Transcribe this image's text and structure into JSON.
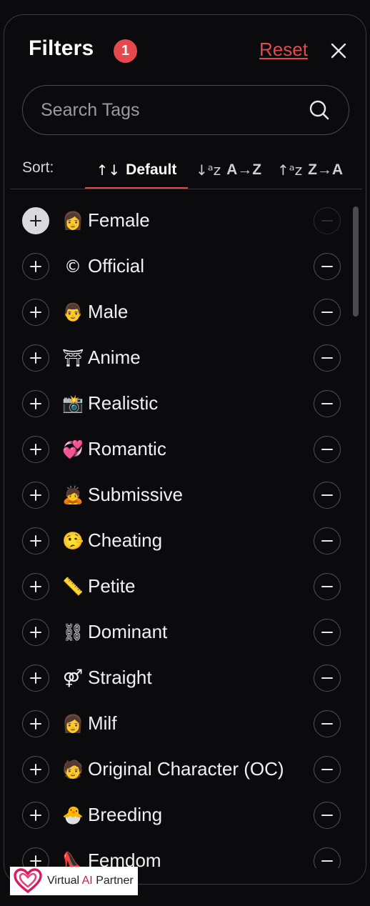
{
  "header": {
    "title": "Filters",
    "active_count": "1",
    "reset_label": "Reset",
    "close_icon": "close-icon"
  },
  "search": {
    "placeholder": "Search Tags",
    "value": "",
    "icon": "search-icon"
  },
  "sort": {
    "label": "Sort:",
    "options": [
      {
        "label": "Default",
        "icon": "↑↓",
        "active": true
      },
      {
        "label": "A→Z",
        "icon": "↓ᵃz",
        "active": false
      },
      {
        "label": "Z→A",
        "icon": "↑ᵃz",
        "active": false
      }
    ],
    "accent_color": "#e5484d"
  },
  "tags": [
    {
      "emoji": "👩",
      "label": "Female"
    },
    {
      "emoji": "©",
      "label": "Official"
    },
    {
      "emoji": "👨",
      "label": "Male"
    },
    {
      "emoji": "⛩",
      "label": "Anime"
    },
    {
      "emoji": "📸",
      "label": "Realistic"
    },
    {
      "emoji": "💞",
      "label": "Romantic"
    },
    {
      "emoji": "🙇",
      "label": "Submissive"
    },
    {
      "emoji": "🤥",
      "label": "Cheating"
    },
    {
      "emoji": "📏",
      "label": "Petite"
    },
    {
      "emoji": "⛓",
      "label": "Dominant"
    },
    {
      "emoji": "⚤",
      "label": "Straight"
    },
    {
      "emoji": "👩",
      "label": "Milf"
    },
    {
      "emoji": "🧑",
      "label": "Original Character (OC)"
    },
    {
      "emoji": "🐣",
      "label": "Breeding"
    },
    {
      "emoji": "👠",
      "label": "Femdom"
    }
  ],
  "watermark": {
    "text_prefix": "Virtual ",
    "text_ai": "AI",
    "text_suffix": " Partner"
  }
}
